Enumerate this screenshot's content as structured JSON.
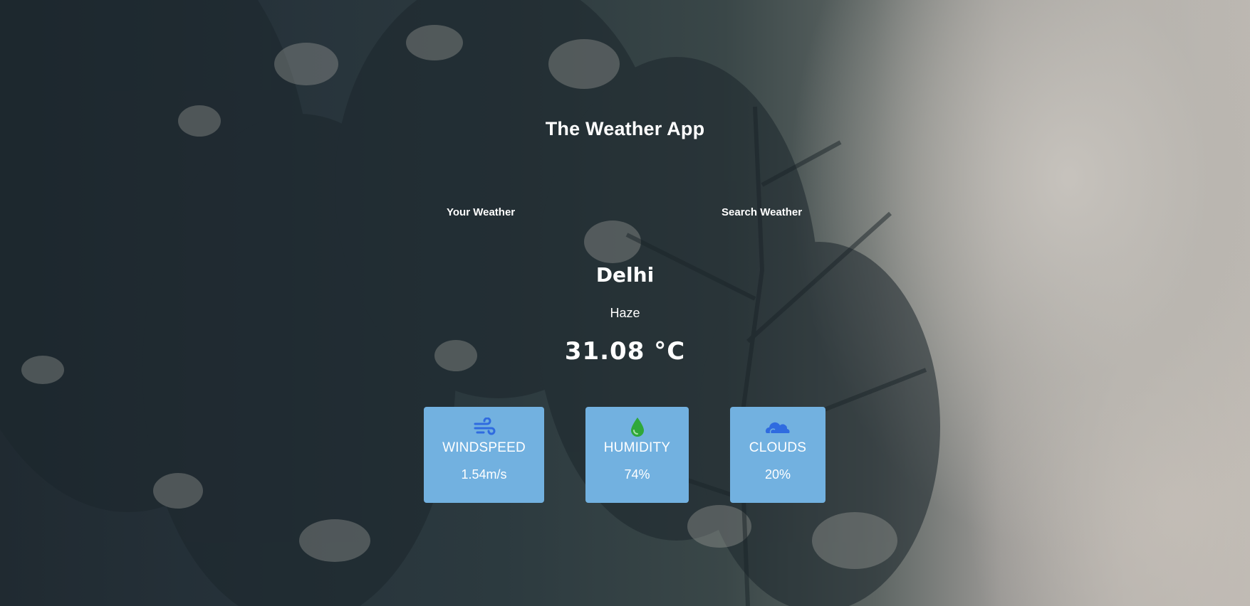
{
  "app": {
    "title": "The Weather App"
  },
  "tabs": [
    {
      "label": "Your Weather"
    },
    {
      "label": "Search Weather"
    }
  ],
  "weather": {
    "city": "Delhi",
    "condition": "Haze",
    "temperature": "31.08 °C"
  },
  "cards": [
    {
      "icon": "wind-icon",
      "label": "WINDSPEED",
      "value": "1.54m/s",
      "icon_color": "#2f6be0"
    },
    {
      "icon": "water-drop-icon",
      "label": "HUMIDITY",
      "value": "74%",
      "icon_color": "#2fa83a"
    },
    {
      "icon": "cloud-icon",
      "label": "CLOUDS",
      "value": "20%",
      "icon_color": "#2f6be0"
    }
  ],
  "colors": {
    "card_background": "#72b1e0",
    "text": "#ffffff"
  }
}
